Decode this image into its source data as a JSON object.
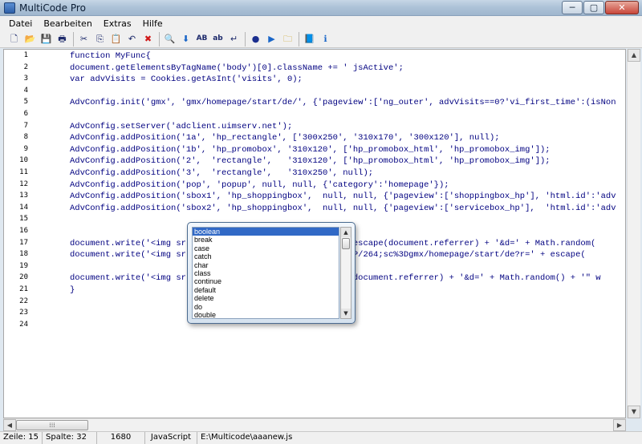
{
  "window": {
    "title": "MultiCode Pro",
    "min_label": "─",
    "max_label": "▢",
    "close_label": "✕"
  },
  "menu": [
    "Datei",
    "Bearbeiten",
    "Extras",
    "Hilfe"
  ],
  "toolbar": {
    "icons": [
      "new-file-icon",
      "open-folder-icon",
      "save-icon",
      "print-icon",
      "cut-icon",
      "copy-icon",
      "paste-icon",
      "undo-icon",
      "delete-icon",
      "find-icon",
      "find-next-icon",
      "match-case-icon",
      "word-icon",
      "replace-icon",
      "info-icon",
      "run-icon",
      "folder-icon",
      "book-icon",
      "help-icon"
    ],
    "glyphs": [
      "🗋",
      "📂",
      "💾",
      "🖶",
      "✂",
      "⎘",
      "📋",
      "↶",
      "✖",
      "🔍",
      "⬇",
      "AB",
      "ab",
      "↵",
      "●",
      "▶",
      "🗀",
      "📘",
      "ℹ"
    ]
  },
  "editor": {
    "line_numbers": [
      "1",
      "2",
      "3",
      "4",
      "5",
      "6",
      "7",
      "8",
      "9",
      "10",
      "11",
      "12",
      "13",
      "14",
      "15",
      "16",
      "17",
      "18",
      "19",
      "20",
      "21",
      "22",
      "23",
      "24"
    ],
    "lines": [
      "function MyFunc{",
      "document.getElementsByTagName('body')[0].className += ' jsActive';",
      "var advVisits = Cookies.getAsInt('visits', 0);",
      "",
      "AdvConfig.init('gmx', 'gmx/homepage/start/de/', {'pageview':['ng_outer', advVisits==0?'vi_first_time':(isNon",
      "",
      "AdvConfig.setServer('adclient.uimserv.net');",
      "AdvConfig.addPosition('1a', 'hp_rectangle', ['300x250', '310x170', '300x120'], null);",
      "AdvConfig.addPosition('1b', 'hp_promobox', '310x120', ['hp_promobox_html', 'hp_promobox_img']);",
      "AdvConfig.addPosition('2',  'rectangle',   '310x120', ['hp_promobox_html', 'hp_promobox_img']);",
      "AdvConfig.addPosition('3',  'rectangle',   '310x250', null);",
      "AdvConfig.addPosition('pop', 'popup', null, null, {'category':'homepage'});",
      "AdvConfig.addPosition('sbox1', 'hp_shoppingbox',  null, null, {'pageview':['shoppingbox_hp'], 'html.id':'adv",
      "AdvConfig.addPosition('sbox2', 'hp_shoppingbox',  null, null, {'pageview':['servicebox_hp'],  'html.id':'adv",
      "",
      "",
      "document.write('<img sr                             ' + escape(document.referrer) + '&d=' + Math.random(",
      "document.write('<img sr                          a/gmx/CP/264;sc%3Dgmx/homepage/start/de?r=' + escape(",
      "",
      "document.write('<img sr                             ape(document.referrer) + '&d=' + Math.random() + '\" w",
      "}",
      "",
      "",
      ""
    ]
  },
  "autocomplete": {
    "items": [
      "boolean",
      "break",
      "case",
      "catch",
      "char",
      "class",
      "continue",
      "default",
      "delete",
      "do",
      "double"
    ],
    "selected_index": 0,
    "scroll_up": "▲",
    "scroll_down": "▼"
  },
  "scrollbars": {
    "up": "▲",
    "down": "▼",
    "left": "◀",
    "right": "▶",
    "grip": "⁞⁞⁞"
  },
  "status": {
    "line": "Zeile: 15",
    "column": "Spalte: 32",
    "count": "1680",
    "language": "JavaScript",
    "path": "E:\\Multicode\\aaanew.js"
  }
}
